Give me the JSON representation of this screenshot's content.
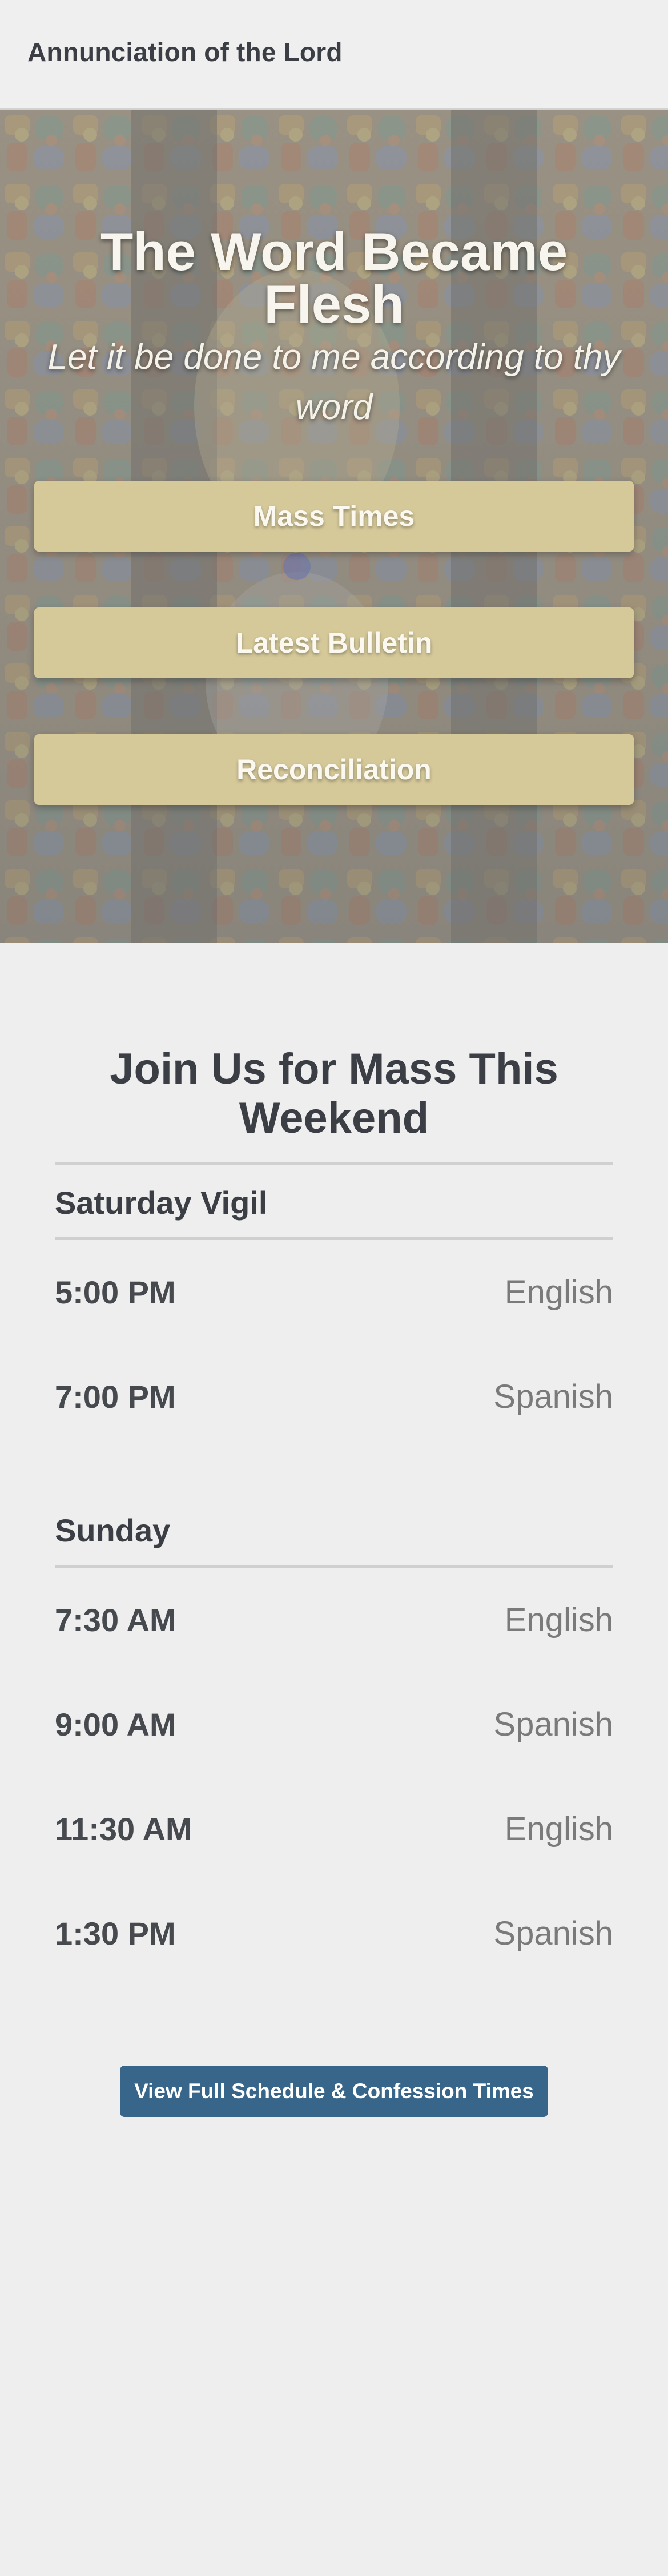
{
  "header": {
    "site_title": "Annunciation of the Lord"
  },
  "hero": {
    "title": "The Word Became Flesh",
    "subtitle": "Let it be done to me according to thy word",
    "buttons": [
      {
        "label": "Mass Times"
      },
      {
        "label": "Latest Bulletin"
      },
      {
        "label": "Reconciliation"
      }
    ]
  },
  "mass": {
    "heading": "Join Us for Mass This Weekend",
    "groups": [
      {
        "title": "Saturday Vigil",
        "rows": [
          {
            "time": "5:00 PM",
            "language": "English"
          },
          {
            "time": "7:00 PM",
            "language": "Spanish"
          }
        ]
      },
      {
        "title": "Sunday",
        "rows": [
          {
            "time": "7:30 AM",
            "language": "English"
          },
          {
            "time": "9:00 AM",
            "language": "Spanish"
          },
          {
            "time": "11:30 AM",
            "language": "English"
          },
          {
            "time": "1:30 PM",
            "language": "Spanish"
          }
        ]
      }
    ],
    "cta_label": "View Full Schedule & Confession Times"
  },
  "colors": {
    "hero_button": "#d5c99a",
    "cta_button": "#37668a",
    "text_dark": "#3b3f45",
    "text_muted": "#7a7a7a"
  }
}
